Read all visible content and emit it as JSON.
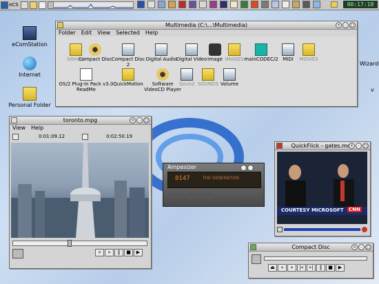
{
  "taskbar": {
    "left_label": "eCS",
    "clock": "00:17:18"
  },
  "desktop": {
    "icons": [
      {
        "label": "eComStation"
      },
      {
        "label": "Internet"
      },
      {
        "label": "Personal Folder"
      }
    ],
    "right_edge_text": "Wizard",
    "right_edge_char": "v"
  },
  "multimedia_window": {
    "title": "Multimedia (C:\\...\\Multimedia)",
    "menu": [
      "Folder",
      "Edit",
      "View",
      "Selected",
      "Help"
    ],
    "items": [
      {
        "label": "bitmap",
        "icon": "folder-icon",
        "dim": true
      },
      {
        "label": "Compact Disc",
        "icon": "cd-icon",
        "dim": false
      },
      {
        "label": "Compact Disc 2",
        "icon": "media-icon",
        "dim": false
      },
      {
        "label": "Digital Audio",
        "icon": "media-icon",
        "dim": false
      },
      {
        "label": "Digital Video",
        "icon": "media-icon",
        "dim": false
      },
      {
        "label": "Image",
        "icon": "image-icon",
        "dim": false
      },
      {
        "label": "IMAGES",
        "icon": "folder-icon",
        "dim": true
      },
      {
        "label": "mainCODEC/2",
        "icon": "book-icon",
        "dim": false
      },
      {
        "label": "MIDI",
        "icon": "midi-icon",
        "dim": false
      },
      {
        "label": "MOVIES",
        "icon": "folder-icon",
        "dim": true
      },
      {
        "label": "OS/2 Plug-In Pack v3.0 ReadMe",
        "icon": "document-icon",
        "dim": false
      },
      {
        "label": "QuickMotion",
        "icon": "folder-icon",
        "dim": false
      },
      {
        "label": "Software VideoCD Player",
        "icon": "cd-icon",
        "dim": false
      },
      {
        "label": "Sound",
        "icon": "media-icon",
        "dim": true
      },
      {
        "label": "SOUNDS",
        "icon": "folder-icon",
        "dim": true
      },
      {
        "label": "Volume",
        "icon": "volume-icon",
        "dim": false
      }
    ]
  },
  "toronto_window": {
    "title": "toronto.mpg",
    "menu": [
      "View",
      "Help"
    ],
    "time_start": "0:01:09.12",
    "time_end": "0:02:50.19",
    "progress": 0.42
  },
  "ampesizer": {
    "title": "Ampesizer",
    "display": "0147",
    "track_text": "THE GENERATION"
  },
  "quickflick": {
    "title": "QuickFlick - gates.mov",
    "caption": "COURTESY MICROSOFT",
    "logo": "CNN"
  },
  "compact_disc": {
    "title": "Compact Disc"
  },
  "colors": {
    "accent": "#e0161b",
    "clock_bg": "#1f3a2a",
    "clock_fg": "#9ef39e"
  }
}
